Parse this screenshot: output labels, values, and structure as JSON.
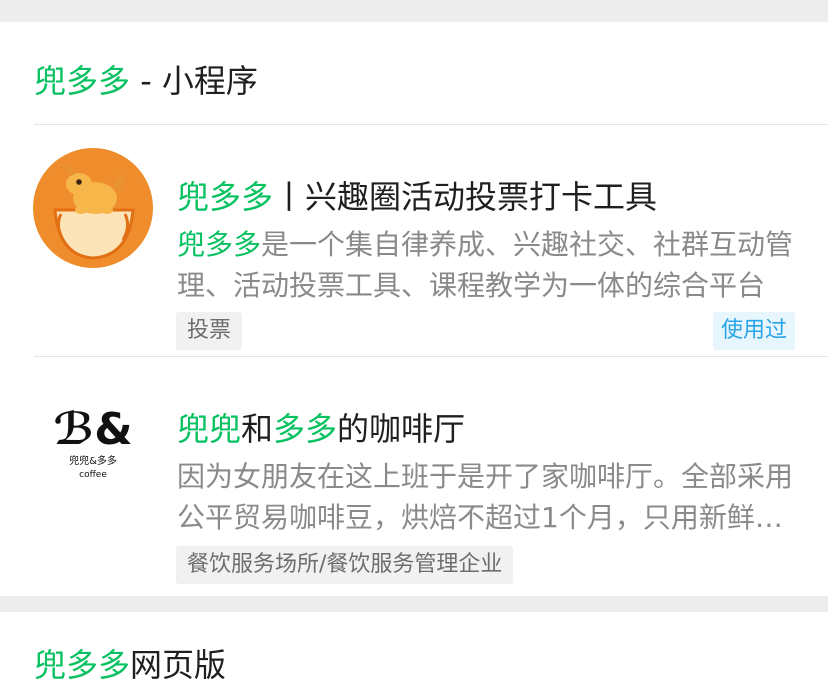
{
  "section1": {
    "title_highlight": "兜多多",
    "title_rest": " - 小程序"
  },
  "items": [
    {
      "title_highlight": "兜多多",
      "title_rest": "丨兴趣圈活动投票打卡工具",
      "desc_highlight": "兜多多",
      "desc_rest": "是一个集自律养成、兴趣社交、社群互动管理、活动投票工具、课程教学为一体的综合平台",
      "tag": "投票",
      "badge": "使用过",
      "logo_icon": "kangaroo-mascot-icon"
    },
    {
      "title_part1": "兜兜",
      "title_part2": "和",
      "title_part3": "多多",
      "title_part4": "的咖啡厅",
      "desc": "因为女朋友在这上班于是开了家咖啡厅。全部采用公平贸易咖啡豆，烘焙不超过1个月，只用新鲜咖啡豆",
      "tag": "餐饮服务场所/餐饮服务管理企业",
      "logo_text": "兜兜&多多",
      "logo_subtext": "coffee",
      "logo_icon": "coffee-brand-logo-icon"
    }
  ],
  "section2": {
    "title_highlight": "兜多多",
    "title_rest": "网页版"
  },
  "colors": {
    "highlight": "#07c160",
    "badge_text": "#2aa5e8",
    "logo_bg": "#ef8d2d"
  }
}
